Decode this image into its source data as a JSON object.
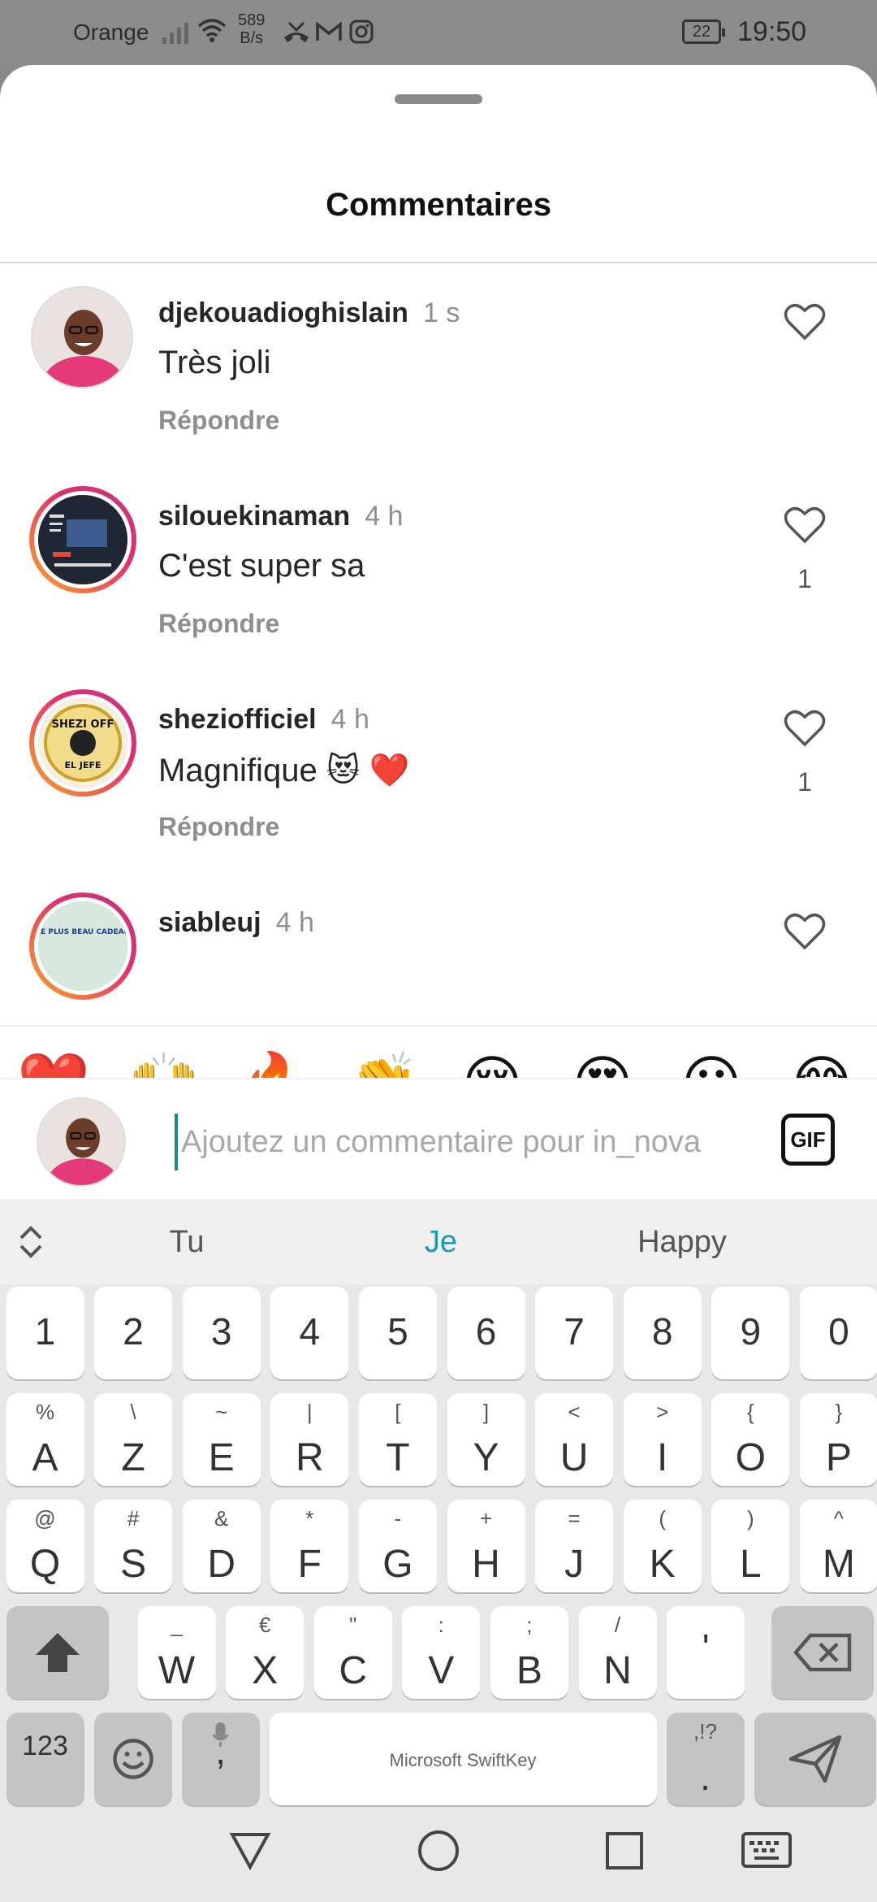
{
  "status_bar": {
    "carrier": "Orange",
    "speed_value": "589",
    "speed_unit": "B/s",
    "battery": "22",
    "time": "19:50",
    "icons": [
      "signal-icon",
      "wifi-icon",
      "missed-call-icon",
      "gmail-icon",
      "instagram-icon"
    ]
  },
  "sheet": {
    "title": "Commentaires"
  },
  "comments": [
    {
      "username": "djekouadioghislain",
      "time": "1 s",
      "text": "Très joli",
      "reply": "Répondre",
      "likes": ""
    },
    {
      "username": "silouekinaman",
      "time": "4 h",
      "text": "C'est super sa",
      "reply": "Répondre",
      "likes": "1"
    },
    {
      "username": "sheziofficiel",
      "time": "4 h",
      "text": "Magnifique 😻 ❤️",
      "reply": "Répondre",
      "likes": "1"
    },
    {
      "username": "siableuj",
      "time": "4 h",
      "text": "",
      "reply": "",
      "likes": ""
    }
  ],
  "avatar_texts": {
    "shezi": "SHEZI OFF",
    "shezi_bottom": "EL JEFE",
    "siableuj": "LE PLUS BEAU CADEAU"
  },
  "reactions": [
    "❤️",
    "🙌",
    "🔥",
    "👏",
    "😢",
    "😍",
    "😮",
    "😂"
  ],
  "input": {
    "placeholder": "Ajoutez un commentaire pour in_nova",
    "gif_label": "GIF"
  },
  "keyboard": {
    "suggestions": [
      "Tu",
      "Je",
      "Happy"
    ],
    "numbers": [
      "1",
      "2",
      "3",
      "4",
      "5",
      "6",
      "7",
      "8",
      "9",
      "0"
    ],
    "row1": [
      {
        "k": "A",
        "s": "%"
      },
      {
        "k": "Z",
        "s": "\\"
      },
      {
        "k": "E",
        "s": "~"
      },
      {
        "k": "R",
        "s": "|"
      },
      {
        "k": "T",
        "s": "["
      },
      {
        "k": "Y",
        "s": "]"
      },
      {
        "k": "U",
        "s": "<"
      },
      {
        "k": "I",
        "s": ">"
      },
      {
        "k": "O",
        "s": "{"
      },
      {
        "k": "P",
        "s": "}"
      }
    ],
    "row2": [
      {
        "k": "Q",
        "s": "@"
      },
      {
        "k": "S",
        "s": "#"
      },
      {
        "k": "D",
        "s": "&"
      },
      {
        "k": "F",
        "s": "*"
      },
      {
        "k": "G",
        "s": "-"
      },
      {
        "k": "H",
        "s": "+"
      },
      {
        "k": "J",
        "s": "="
      },
      {
        "k": "K",
        "s": "("
      },
      {
        "k": "L",
        "s": ")"
      },
      {
        "k": "M",
        "s": "^"
      }
    ],
    "row3": [
      {
        "k": "W",
        "s": "_"
      },
      {
        "k": "X",
        "s": "€"
      },
      {
        "k": "C",
        "s": "\""
      },
      {
        "k": "V",
        "s": ":"
      },
      {
        "k": "B",
        "s": ";"
      },
      {
        "k": "N",
        "s": "/"
      },
      {
        "k": "'",
        "s": ""
      }
    ],
    "key_123": "123",
    "comma": ",",
    "period": ".",
    "period_sub": ",!?",
    "space_label": "Microsoft SwiftKey"
  }
}
